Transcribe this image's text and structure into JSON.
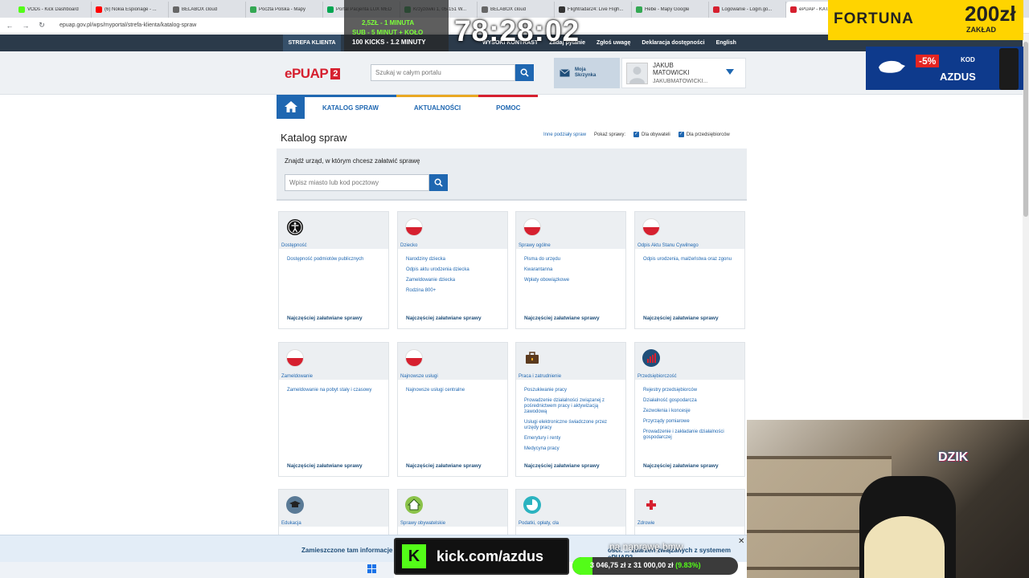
{
  "browser": {
    "tabs": [
      {
        "label": "VODs - Kick Dashboard",
        "color": "#53fc18"
      },
      {
        "label": "(6) Nokia Espionage - ...",
        "color": "#ff0000"
      },
      {
        "label": "BELABOX cloud",
        "color": "#666666"
      },
      {
        "label": "Poczta Polska - Mapy",
        "color": "#34a853"
      },
      {
        "label": "Portal Pacjenta LUX MED",
        "color": "#00a651"
      },
      {
        "label": "Krzyżówki 1, 05-151 W...",
        "color": "#34a853"
      },
      {
        "label": "BELABOX cloud",
        "color": "#666666"
      },
      {
        "label": "Flightradar24: Live Fligh...",
        "color": "#333333"
      },
      {
        "label": "Hebe - Mapy Google",
        "color": "#34a853"
      },
      {
        "label": "Logowanie - Login.go...",
        "color": "#d6202f"
      },
      {
        "label": "ePUAP - KATA...",
        "color": "#d6202f",
        "active": true
      }
    ],
    "url": "epuap.gov.pl/wps/myportal/strefa-klienta/katalog-spraw"
  },
  "topstrip": {
    "strefa": "STREFA KLIENTA",
    "links": [
      "WYSOKI KONTRAST",
      "Zadaj pytanie",
      "Zgłoś uwagę",
      "Deklaracja dostępności",
      "English"
    ]
  },
  "header": {
    "logo": "ePUAP",
    "logo_num": "2",
    "search_placeholder": "Szukaj w całym portalu",
    "mailbox_l1": "Moja",
    "mailbox_l2": "Skrzynka",
    "user_first": "JAKUB",
    "user_last": "MATOWICKI",
    "user_login": "JAKUBMATOWICKI..."
  },
  "nav": {
    "items": [
      "KATALOG SPRAW",
      "AKTUALNOŚCI",
      "POMOC"
    ]
  },
  "page": {
    "title": "Katalog spraw",
    "filter_link": "Inne podziały spraw",
    "show_label": "Pokaż sprawy:",
    "chk1": "Dla obywateli",
    "chk2": "Dla przedsiębiorców",
    "find_label": "Znajdź urząd, w którym chcesz załatwić sprawę",
    "city_placeholder": "Wpisz miasto lub kod pocztowy"
  },
  "common_link": "Najczęściej załatwiane sprawy",
  "cards": [
    {
      "title": "Dostępność",
      "icon": "accessibility-icon",
      "links": [
        "Dostępność podmiotów publicznych"
      ]
    },
    {
      "title": "Dziecko",
      "icon": "flag-icon",
      "links": [
        "Narodziny dziecka",
        "Odpis aktu urodzenia dziecka",
        "Zameldowanie dziecka",
        "Rodzina 800+"
      ]
    },
    {
      "title": "Sprawy ogólne",
      "icon": "flag-icon",
      "links": [
        "Pisma do urzędu",
        "Kwarantanna",
        "Wpłaty obowiązkowe"
      ]
    },
    {
      "title": "Odpis Aktu Stanu Cywilnego",
      "icon": "flag-icon",
      "links": [
        "Odpis urodzenia, małżeństwa oraz zgonu"
      ]
    },
    {
      "title": "Zameldowanie",
      "icon": "flag-icon",
      "links": [
        "Zameldowanie na pobyt stały i czasowy"
      ]
    },
    {
      "title": "Najnowsze usługi",
      "icon": "flag-icon",
      "links": [
        "Najnowsze usługi centralne"
      ]
    },
    {
      "title": "Praca i zatrudnienie",
      "icon": "briefcase-icon",
      "links": [
        "Poszukiwanie pracy",
        "Prowadzenie działalności związanej z pośrednictwem pracy i aktywizacją zawodową",
        "Usługi elektroniczne świadczone przez urzędy pracy",
        "Emerytury i renty",
        "Medycyna pracy"
      ]
    },
    {
      "title": "Przedsiębiorczość",
      "icon": "chart-icon",
      "links": [
        "Rejestry przedsiębiorców",
        "Działalność gospodarcza",
        "Zezwolenia i koncesje",
        "Przyrządy pomiarowe",
        "Prowadzenie i zakładanie działalności gospodarczej"
      ]
    },
    {
      "title": "Edukacja",
      "icon": "graduation-cap-icon",
      "links": []
    },
    {
      "title": "Sprawy obywatelskie",
      "icon": "house-icon",
      "links": []
    },
    {
      "title": "Podatki, opłaty, cła",
      "icon": "pie-icon",
      "links": []
    },
    {
      "title": "Zdrowie",
      "icon": "cross-icon",
      "links": []
    }
  ],
  "overlay": {
    "counter_l1": "2,5ZŁ - 1 MINUTA",
    "counter_l2": "SUB - 5 MINUT + KOŁO",
    "counter_l3": "100 KICKS - 1.2 MINUTY",
    "timer": "78:28:02",
    "fortuna_brand": "FORTUNA",
    "fortuna_amount": "200zł",
    "fortuna_sub": "ZAKŁAD",
    "dzik_pct": "-5%",
    "dzik_kod": "KOD",
    "dzik_code": "AZDUS",
    "dzik_logo": "DZIK",
    "info_text": "Zamieszczone tam informacje",
    "info_text2": "ości. ... zdarzeń związanych z systemem ePUAP2.",
    "info_close": "✕",
    "kick_text": "kick.com/azdus",
    "goal_title": "na naprawę bmw",
    "goal_amount": "3 046,75 zł z 31 000,00 zł",
    "goal_pct_text": "(9.83%)",
    "goal_fraction": 0.0983
  }
}
